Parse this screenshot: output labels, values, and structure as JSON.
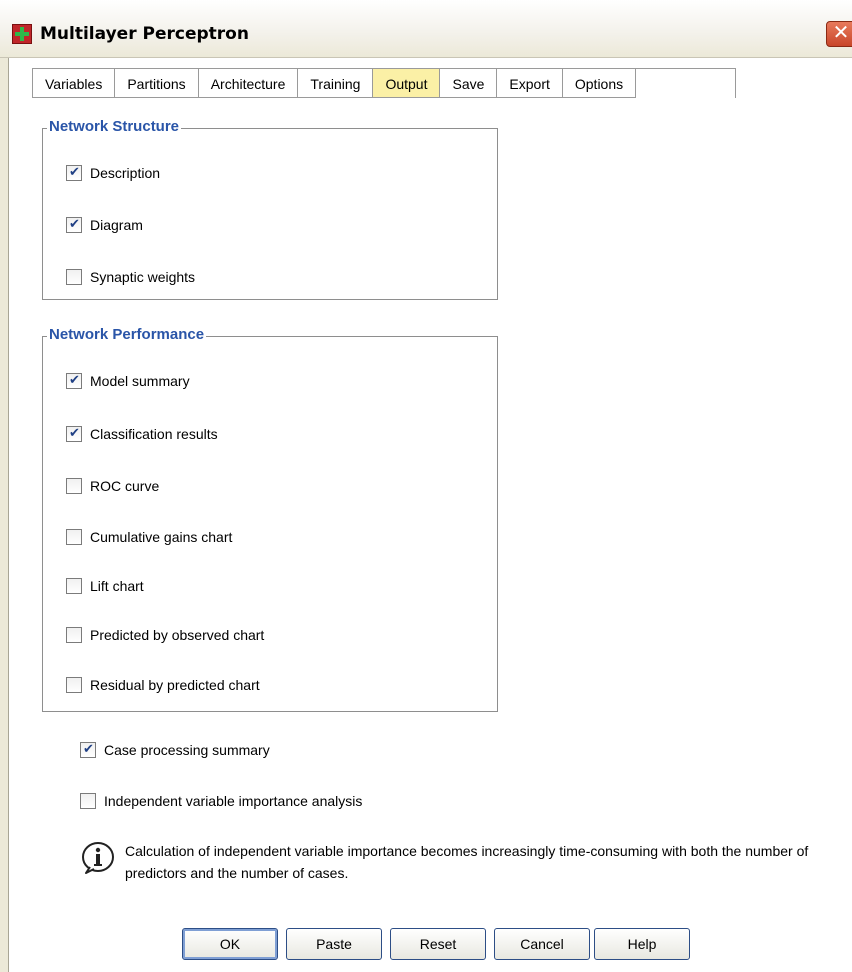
{
  "window": {
    "title": "Multilayer Perceptron",
    "close_glyph": "✕"
  },
  "tabs": [
    {
      "label": "Variables",
      "active": false
    },
    {
      "label": "Partitions",
      "active": false
    },
    {
      "label": "Architecture",
      "active": false
    },
    {
      "label": "Training",
      "active": false
    },
    {
      "label": "Output",
      "active": true
    },
    {
      "label": "Save",
      "active": false
    },
    {
      "label": "Export",
      "active": false
    },
    {
      "label": "Options",
      "active": false
    }
  ],
  "network_structure": {
    "title": "Network Structure",
    "items": [
      {
        "label": "Description",
        "checked": true
      },
      {
        "label": "Diagram",
        "checked": true
      },
      {
        "label": "Synaptic weights",
        "checked": false
      }
    ]
  },
  "network_performance": {
    "title": "Network Performance",
    "items": [
      {
        "label": "Model summary",
        "checked": true
      },
      {
        "label": "Classification results",
        "checked": true
      },
      {
        "label": "ROC curve",
        "checked": false
      },
      {
        "label": "Cumulative gains chart",
        "checked": false
      },
      {
        "label": "Lift chart",
        "checked": false
      },
      {
        "label": "Predicted by observed chart",
        "checked": false
      },
      {
        "label": "Residual by predicted chart",
        "checked": false
      }
    ]
  },
  "extra_options": [
    {
      "label": "Case processing summary",
      "checked": true
    },
    {
      "label": "Independent variable importance analysis",
      "checked": false
    }
  ],
  "info": {
    "icon": "info-icon",
    "text": "Calculation of independent variable importance becomes increasingly time-consuming with both the number of predictors and the number of cases."
  },
  "buttons": {
    "ok": "OK",
    "paste": "Paste",
    "reset": "Reset",
    "cancel": "Cancel",
    "help": "Help"
  },
  "colors": {
    "group_title": "#2a55a8",
    "active_tab": "#fbf0a6",
    "close_button": "#c8462a"
  }
}
